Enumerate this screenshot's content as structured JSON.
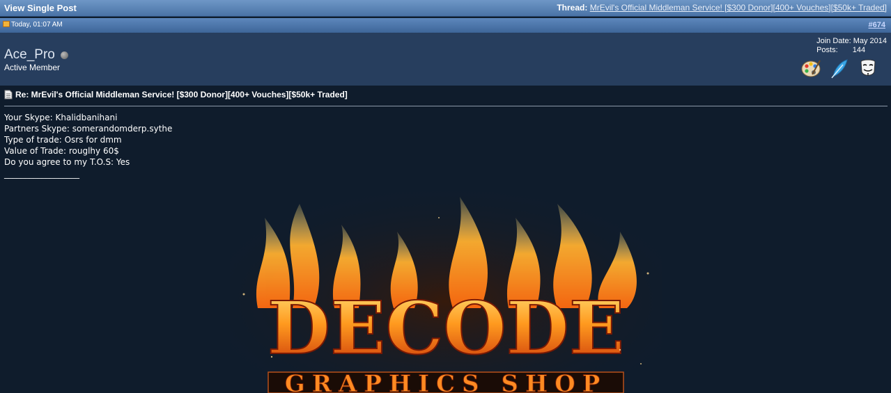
{
  "header": {
    "title": "View Single Post",
    "thread_label": "Thread:",
    "thread_link": "MrEvil's Official Middleman Service! [$300 Donor][400+ Vouches][$50k+ Traded]"
  },
  "post_meta": {
    "date": "Today, 01:07 AM",
    "post_number": "#674"
  },
  "user": {
    "name": "Ace_Pro",
    "title": "Active Member",
    "join_label": "Join Date:",
    "join_value": "May 2014",
    "posts_label": "Posts:",
    "posts_value": "144",
    "awards": [
      "palette-icon",
      "feather-icon",
      "guy-fawkes-mask-icon"
    ]
  },
  "post": {
    "title": "Re: MrEvil's Official Middleman Service! [$300 Donor][400+ Vouches][$50k+ Traded]",
    "lines": [
      "Your Skype: Khalidbanihani",
      "Partners Skype: somerandomderp.sythe",
      "Type of trade: Osrs for dmm",
      "Value of Trade: rouglhy 60$",
      "Do you agree to my T.O.S: Yes"
    ],
    "signature_separator": "__________________"
  },
  "banner": {
    "main_text": "DECODE",
    "sub_text": "GRAPHICS SHOP"
  },
  "colors": {
    "header_blue": "#5a83b6",
    "user_bar": "#273e5e",
    "post_bg": "#0f1c2c",
    "fire_orange": "#ff7a18"
  }
}
